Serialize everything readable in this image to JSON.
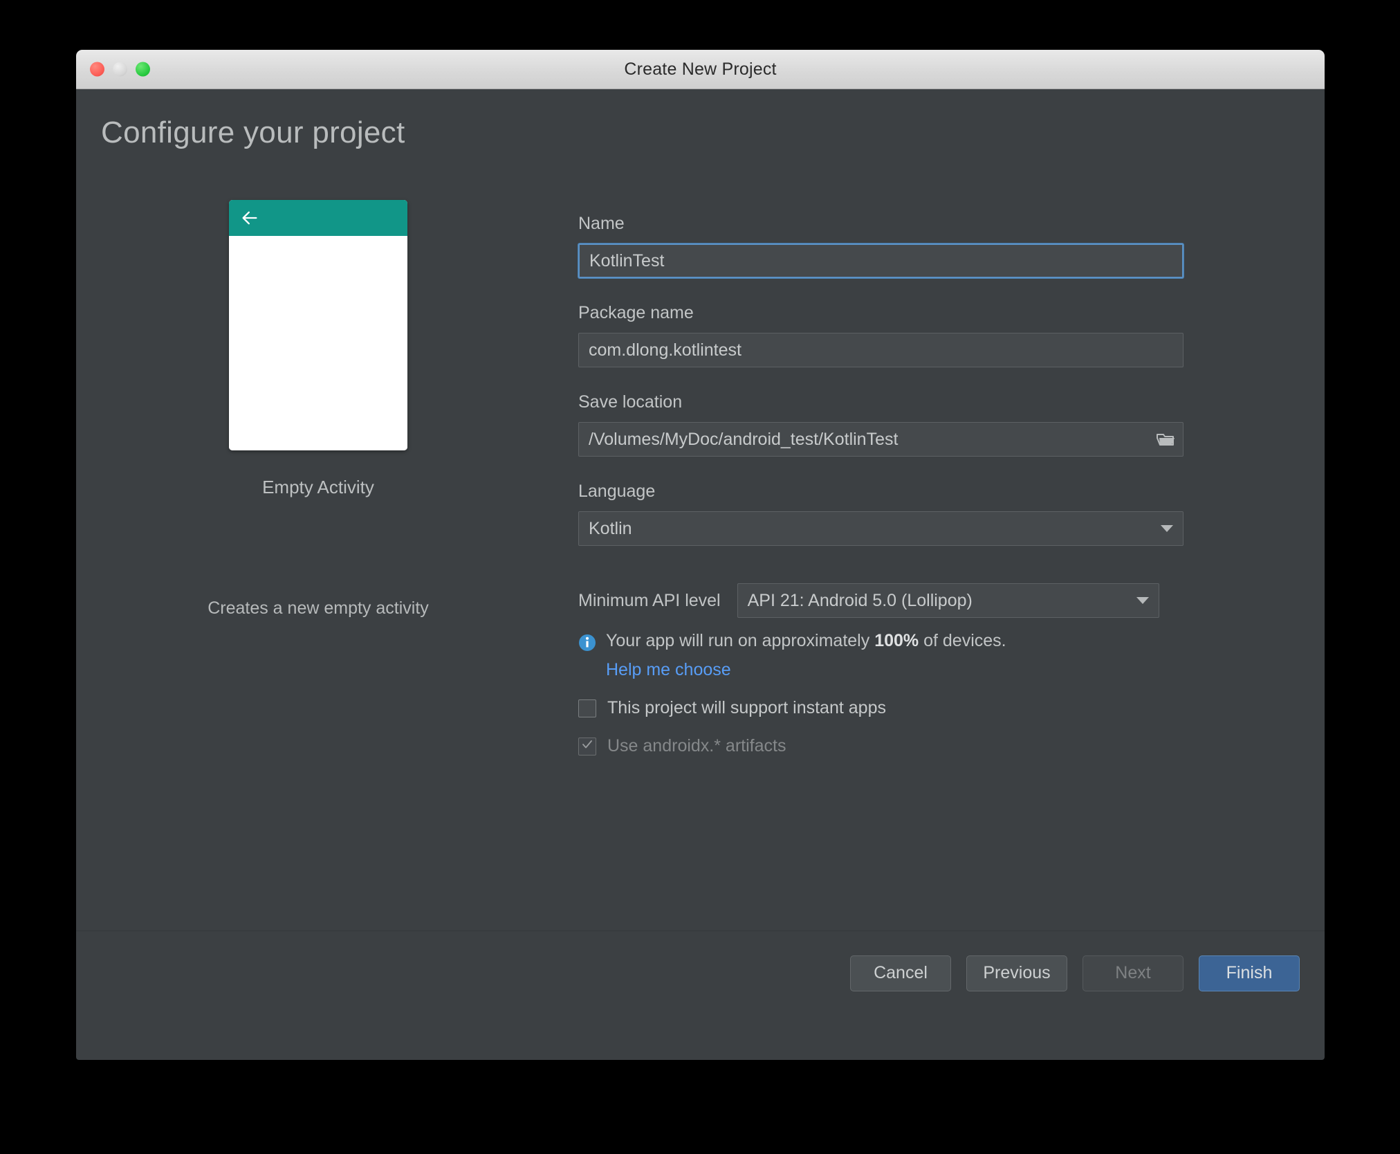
{
  "window": {
    "title": "Create New Project",
    "traffic_lights": [
      "close",
      "minimize",
      "zoom"
    ]
  },
  "page": {
    "heading": "Configure your project"
  },
  "preview": {
    "caption": "Empty Activity",
    "description": "Creates a new empty activity",
    "appbar_color": "#119688",
    "back_icon": "back-arrow-icon"
  },
  "form": {
    "name": {
      "label": "Name",
      "value": "KotlinTest",
      "placeholder": "",
      "focused": true
    },
    "package_name": {
      "label": "Package name",
      "value": "com.dlong.kotlintest",
      "placeholder": ""
    },
    "save_location": {
      "label": "Save location",
      "value": "/Volumes/MyDoc/android_test/KotlinTest",
      "placeholder": "",
      "browse_icon": "folder-icon"
    },
    "language": {
      "label": "Language",
      "value": "Kotlin"
    },
    "min_api": {
      "label": "Minimum API level",
      "value": "API 21: Android 5.0 (Lollipop)"
    },
    "device_info": {
      "icon": "info-icon",
      "text_before": "Your app will run on approximately ",
      "percent": "100%",
      "text_after": " of devices.",
      "link": "Help me choose",
      "link_color": "#589df6",
      "icon_color": "#3b92d0"
    },
    "instant_apps_checkbox": {
      "label": "This project will support instant apps",
      "checked": false,
      "disabled": false
    },
    "androidx_checkbox": {
      "label": "Use androidx.* artifacts",
      "checked": true,
      "disabled": true
    }
  },
  "footer": {
    "cancel": "Cancel",
    "previous": "Previous",
    "next": "Next",
    "finish": "Finish",
    "next_disabled": true,
    "finish_color": "#3c6495"
  }
}
